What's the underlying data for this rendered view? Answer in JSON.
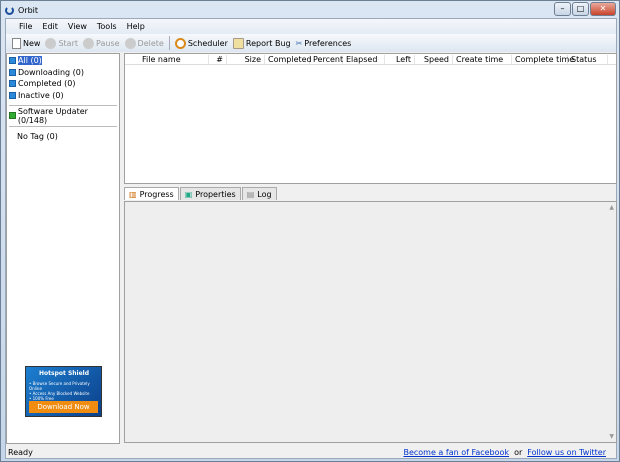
{
  "window": {
    "title": "Orbit"
  },
  "menu": [
    "File",
    "Edit",
    "View",
    "Tools",
    "Help"
  ],
  "toolbar": {
    "new": "New",
    "start": "Start",
    "pause": "Pause",
    "delete": "Delete",
    "scheduler": "Scheduler",
    "report_bug": "Report Bug",
    "preferences": "Preferences"
  },
  "sidebar": {
    "items": [
      "All (0)",
      "Downloading (0)",
      "Completed (0)",
      "Inactive (0)"
    ],
    "updater": "Software Updater (0/148)",
    "tag": "No Tag (0)"
  },
  "ad": {
    "title": "Hotspot Shield",
    "lines": [
      "• Browse Secure and Privately Online",
      "• Access Any Blocked Website",
      "• 100% Free"
    ],
    "button": "Download Now"
  },
  "columns": [
    "File name",
    "#",
    "Size",
    "Completed",
    "Percent",
    "Elapsed",
    "Left",
    "Speed",
    "Create time",
    "Complete time",
    "Status"
  ],
  "tabs": [
    "Progress",
    "Properties",
    "Log"
  ],
  "status": {
    "text": "Ready",
    "fan_link": "Become a fan of Facebook",
    "or": "or",
    "twitter_link": "Follow us on Twitter"
  }
}
